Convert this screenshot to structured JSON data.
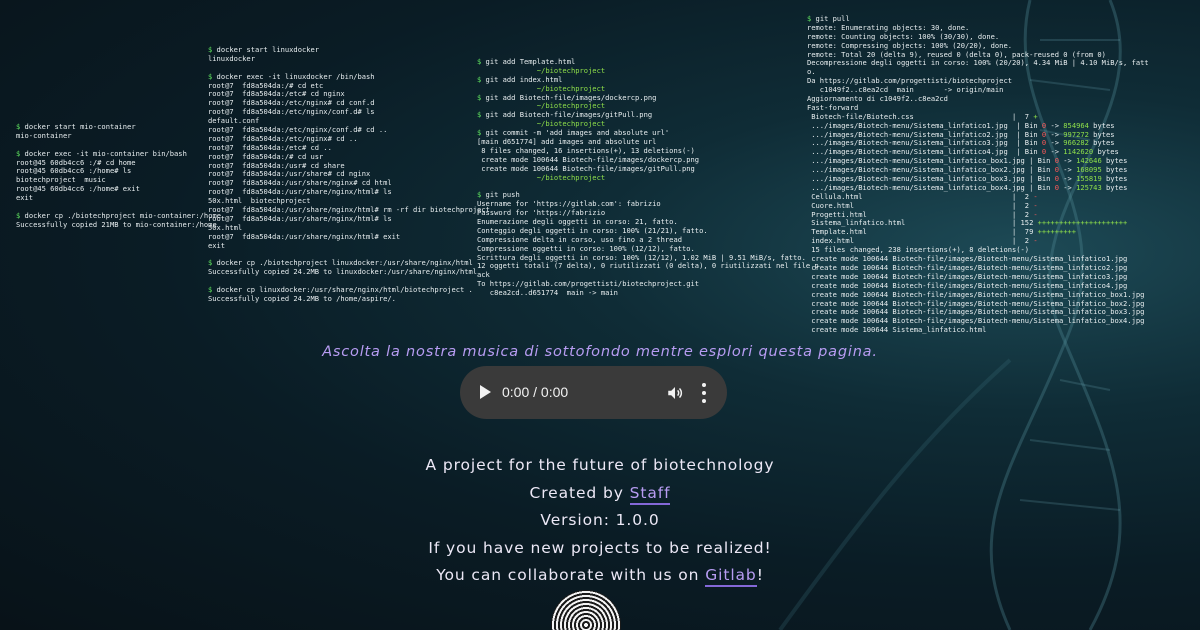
{
  "terminals": {
    "a": [
      "$ docker start mio-container",
      "mio-container",
      "",
      "$ docker exec -it mio-container bin/bash",
      "root@45 60db4cc6 :/# cd home",
      "root@45 60db4cc6 :/home# ls",
      "biotechproject  music",
      "root@45 60db4cc6 :/home# exit",
      "exit",
      "",
      "$ docker cp ./biotechproject mio-container:/home",
      "Successfully copied 21MB to mio-container:/home"
    ],
    "b": [
      "$ docker start linuxdocker",
      "linuxdocker",
      "",
      "$ docker exec -it linuxdocker /bin/bash",
      "root@7  fd8a504da:/# cd etc",
      "root@7  fd8a504da:/etc# cd nginx",
      "root@7  fd8a504da:/etc/nginx# cd conf.d",
      "root@7  fd8a504da:/etc/nginx/conf.d# ls",
      "default.conf",
      "root@7  fd8a504da:/etc/nginx/conf.d# cd ..",
      "root@7  fd8a504da:/etc/nginx# cd ..",
      "root@7  fd8a504da:/etc# cd ..",
      "root@7  fd8a504da:/# cd usr",
      "root@7  fd8a504da:/usr# cd share",
      "root@7  fd8a504da:/usr/share# cd nginx",
      "root@7  fd8a504da:/usr/share/nginx# cd html",
      "root@7  fd8a504da:/usr/share/nginx/html# ls",
      "50x.html  biotechproject",
      "root@7  fd8a504da:/usr/share/nginx/html# rm -rf dir biotechproject",
      "root@7  fd8a504da:/usr/share/nginx/html# ls",
      "50x.html",
      "root@7  fd8a504da:/usr/share/nginx/html# exit",
      "exit",
      "",
      "$ docker cp ./biotechproject linuxdocker:/usr/share/nginx/html",
      "Successfully copied 24.2MB to linuxdocker:/usr/share/nginx/html",
      "",
      "$ docker cp linuxdocker:/usr/share/nginx/html/biotechproject .",
      "Successfully copied 24.2MB to /home/aspire/."
    ],
    "c": [
      "$ git add Template.html",
      "              ~/biotechproject",
      "$ git add index.html",
      "              ~/biotechproject",
      "$ git add Biotech-file/images/dockercp.png",
      "              ~/biotechproject",
      "$ git add Biotech-file/images/gitPull.png",
      "              ~/biotechproject",
      "$ git commit -m 'add images and absolute url'",
      "[main d651774] add images and absolute url",
      " 8 files changed, 16 insertions(+), 13 deletions(-)",
      " create mode 100644 Biotech-file/images/dockercp.png",
      " create mode 100644 Biotech-file/images/gitPull.png",
      "              ~/biotechproject",
      "",
      "$ git push",
      "Username for 'https://gitlab.com': fabrizio",
      "Password for 'https://fabrizio",
      "Enumerazione degli oggetti in corso: 21, fatto.",
      "Conteggio degli oggetti in corso: 100% (21/21), fatto.",
      "Compressione delta in corso, uso fino a 2 thread",
      "Compressione oggetti in corso: 100% (12/12), fatto.",
      "Scrittura degli oggetti in corso: 100% (12/12), 1.02 MiB | 9.51 MiB/s, fatto.",
      "12 oggetti totali (7 delta), 0 riutilizzati (0 delta), 0 riutilizzati nel file p",
      "ack",
      "To https://gitlab.com/progettisti/biotechproject.git",
      "   c8ea2cd..d651774  main -> main"
    ],
    "d": [
      "$ git pull",
      "remote: Enumerating objects: 30, done.",
      "remote: Counting objects: 100% (30/30), done.",
      "remote: Compressing objects: 100% (20/20), done.",
      "remote: Total 20 (delta 9), reused 0 (delta 0), pack-reused 0 (from 0)",
      "Decompressione degli oggetti in corso: 100% (20/20), 4.34 MiB | 4.10 MiB/s, fatt",
      "o.",
      "Da https://gitlab.com/progettisti/biotechproject",
      "   c1049f2..c8ea2cd  main       -> origin/main",
      "Aggiornamento di c1049f2..c8ea2cd",
      "Fast-forward",
      " Biotech-file/Biotech.css                       |  7 +",
      " .../images/Biotech-menu/Sistema_linfatico1.jpg  | Bin 0 -> 854964 bytes",
      " .../images/Biotech-menu/Sistema_linfatico2.jpg  | Bin 0 -> 997272 bytes",
      " .../images/Biotech-menu/Sistema_linfatico3.jpg  | Bin 0 -> 966282 bytes",
      " .../images/Biotech-menu/Sistema_linfatico4.jpg  | Bin 0 -> 1142620 bytes",
      " .../images/Biotech-menu/Sistema_linfatico_box1.jpg | Bin 0 -> 142646 bytes",
      " .../images/Biotech-menu/Sistema_linfatico_box2.jpg | Bin 0 -> 168095 bytes",
      " .../images/Biotech-menu/Sistema_linfatico_box3.jpg | Bin 0 -> 155819 bytes",
      " .../images/Biotech-menu/Sistema_linfatico_box4.jpg | Bin 0 -> 125743 bytes",
      " Cellula.html                                   |  2 -",
      " Cuore.html                                     |  2 -",
      " Progetti.html                                  |  2 -",
      " Sistema_linfatico.html                         | 152 +++++++++++++++++++++",
      " Template.html                                  |  79 +++++++++",
      " index.html                                     |  2 -",
      " 15 files changed, 238 insertions(+), 8 deletions(-)",
      " create mode 100644 Biotech-file/images/Biotech-menu/Sistema_linfatico1.jpg",
      " create mode 100644 Biotech-file/images/Biotech-menu/Sistema_linfatico2.jpg",
      " create mode 100644 Biotech-file/images/Biotech-menu/Sistema_linfatico3.jpg",
      " create mode 100644 Biotech-file/images/Biotech-menu/Sistema_linfatico4.jpg",
      " create mode 100644 Biotech-file/images/Biotech-menu/Sistema_linfatico_box1.jpg",
      " create mode 100644 Biotech-file/images/Biotech-menu/Sistema_linfatico_box2.jpg",
      " create mode 100644 Biotech-file/images/Biotech-menu/Sistema_linfatico_box3.jpg",
      " create mode 100644 Biotech-file/images/Biotech-menu/Sistema_linfatico_box4.jpg",
      " create mode 100644 Sistema_linfatico.html"
    ]
  },
  "music_caption": "Ascolta la nostra musica di sottofondo mentre esplori questa pagina.",
  "audio_player": {
    "time": "0:00 / 0:00",
    "icons": {
      "play": "play-icon",
      "volume": "volume-icon",
      "more": "more-vertical-icon"
    }
  },
  "info": {
    "line1": "A project for the future of biotechnology",
    "created_by_prefix": "Created by ",
    "created_by_link": "Staff",
    "version": "Version: 1.0.0",
    "line4": "If you have new projects to be realized!",
    "collab_prefix": "You can collaborate with us on ",
    "collab_link": "Gitlab",
    "collab_suffix": "!"
  },
  "colors": {
    "accent_purple": "#b79cf2",
    "terminal_prompt": "#5ee05e",
    "diff_add": "#8fe04a",
    "diff_del": "#ff5a5a",
    "player_bg": "#3a3a3a"
  }
}
